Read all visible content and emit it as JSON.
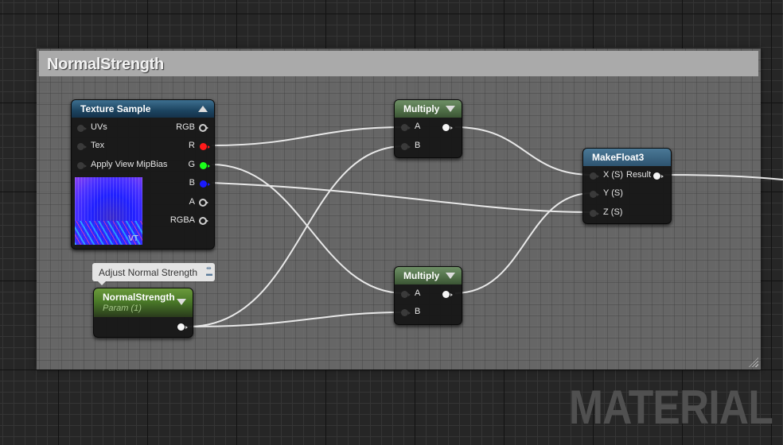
{
  "comment": {
    "title": "NormalStrength"
  },
  "nodes": {
    "texture_sample": {
      "title": "Texture Sample",
      "inputs": [
        "UVs",
        "Tex",
        "Apply View MipBias"
      ],
      "outputs": [
        "RGB",
        "R",
        "G",
        "B",
        "A",
        "RGBA"
      ],
      "preview_label": "VT"
    },
    "multiply_top": {
      "title": "Multiply",
      "inputs": [
        "A",
        "B"
      ]
    },
    "multiply_bottom": {
      "title": "Multiply",
      "inputs": [
        "A",
        "B"
      ]
    },
    "make_float3": {
      "title": "MakeFloat3",
      "inputs": [
        "X (S)",
        "Y (S)",
        "Z (S)"
      ],
      "output": "Result"
    },
    "param": {
      "title": "NormalStrength",
      "subtitle": "Param (1)",
      "comment": "Adjust Normal Strength"
    }
  },
  "pin_colors": {
    "R": "#ff1a1a",
    "G": "#1aff1a",
    "B": "#1a1aff"
  },
  "watermark": "MATERIAL"
}
